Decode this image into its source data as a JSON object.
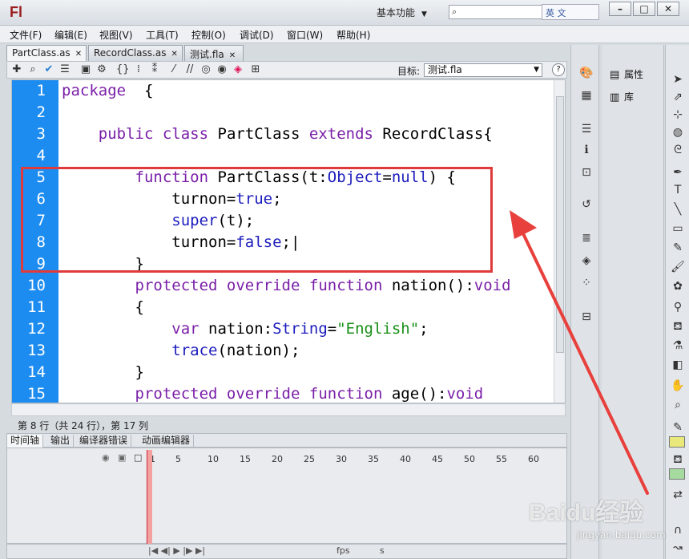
{
  "app": {
    "logo": "Fl",
    "workspace": "基本功能",
    "ime_label": "英 文"
  },
  "menu": [
    "文件(F)",
    "编辑(E)",
    "视图(V)",
    "工具(T)",
    "控制(O)",
    "调试(D)",
    "窗口(W)",
    "帮助(H)"
  ],
  "tabs": [
    {
      "label": "PartClass.as",
      "active": true
    },
    {
      "label": "RecordClass.as",
      "active": false
    },
    {
      "label": "测试.fla",
      "active": false
    }
  ],
  "toolbar": {
    "target_label": "目标:",
    "target_value": "测试.fla",
    "help": "?"
  },
  "code": {
    "lines": [
      {
        "n": "1",
        "html": "<span class=\"kw2\">package</span>  {"
      },
      {
        "n": "2",
        "html": ""
      },
      {
        "n": "3",
        "html": "    <span class=\"kw2\">public</span> <span class=\"kw2\">class</span> PartClass <span class=\"kw2\">extends</span> RecordClass{"
      },
      {
        "n": "4",
        "html": ""
      },
      {
        "n": "5",
        "html": "        <span class=\"kw2\">function</span> PartClass(t:<span class=\"ty\">Object</span>=<span class=\"kw\">null</span>) {"
      },
      {
        "n": "6",
        "html": "            turnon=<span class=\"kw\">true</span>;"
      },
      {
        "n": "7",
        "html": "            <span class=\"kw\">super</span>(t);"
      },
      {
        "n": "8",
        "html": "            turnon=<span class=\"kw\">false</span>;|"
      },
      {
        "n": "9",
        "html": "        }"
      },
      {
        "n": "10",
        "html": "        <span class=\"kw2\">protected</span> <span class=\"kw2\">override</span> <span class=\"kw2\">function</span> nation():<span class=\"kw2\">void</span>"
      },
      {
        "n": "11",
        "html": "        {"
      },
      {
        "n": "12",
        "html": "            <span class=\"kw2\">var</span> nation:<span class=\"ty\">String</span>=<span class=\"str\">\"English\"</span>;"
      },
      {
        "n": "13",
        "html": "            <span class=\"kw\">trace</span>(nation);"
      },
      {
        "n": "14",
        "html": "        }"
      },
      {
        "n": "15",
        "html": "        <span class=\"kw2\">protected</span> <span class=\"kw2\">override</span> <span class=\"kw2\">function</span> age():<span class=\"kw2\">void</span>"
      }
    ]
  },
  "status": "第 8 行（共 24 行），第 17 列",
  "bottom_tabs": [
    "时间轴",
    "输出",
    "编译器错误",
    "动画编辑器"
  ],
  "timeline": {
    "ticks": [
      "1",
      "5",
      "10",
      "15",
      "20",
      "25",
      "30",
      "35",
      "40",
      "45",
      "50",
      "55",
      "60"
    ],
    "fps_label": "fps",
    "sec_label": "s"
  },
  "panels": {
    "properties": "属性",
    "library": "库"
  },
  "watermark": {
    "brand": "Baidu经验",
    "url": "jingyan.baidu.com"
  },
  "colors": {
    "gutter": "#1d8cf0",
    "highlight": "#e03b3b"
  }
}
